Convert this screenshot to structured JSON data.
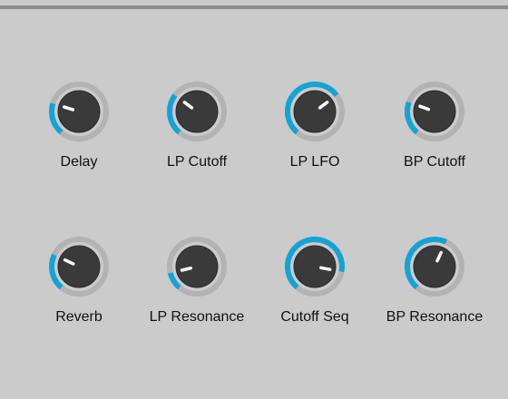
{
  "colors": {
    "panel_bg": "#cbcbcb",
    "top_bar": "#8c8c8c",
    "track": "#b3b3b3",
    "accent": "#14a3d6",
    "knob_body": "#3a3a3a",
    "indicator": "#ffffff",
    "label_text": "#111111"
  },
  "knobs": [
    {
      "id": "delay",
      "label": "Delay",
      "value": 0.24
    },
    {
      "id": "lp-cutoff",
      "label": "LP Cutoff",
      "value": 0.31
    },
    {
      "id": "lp-lfo",
      "label": "LP LFO",
      "value": 0.69
    },
    {
      "id": "bp-cutoff",
      "label": "BP Cutoff",
      "value": 0.25
    },
    {
      "id": "reverb",
      "label": "Reverb",
      "value": 0.27
    },
    {
      "id": "lp-resonance",
      "label": "LP Resonance",
      "value": 0.13
    },
    {
      "id": "cutoff-seq",
      "label": "Cutoff Seq",
      "value": 0.86
    },
    {
      "id": "bp-resonance",
      "label": "BP Resonance",
      "value": 0.59
    }
  ]
}
